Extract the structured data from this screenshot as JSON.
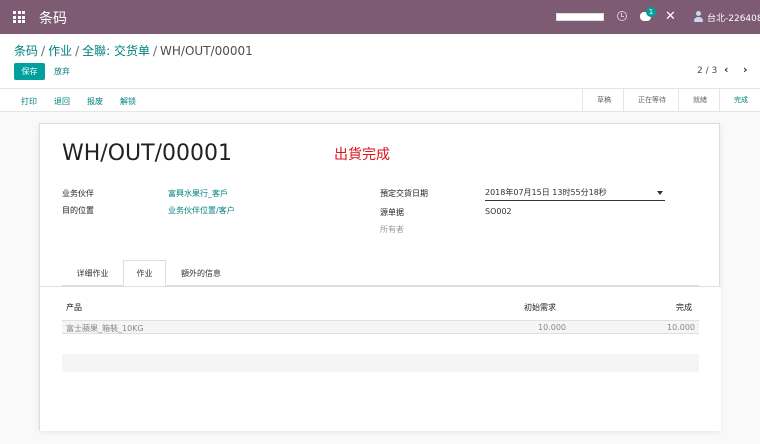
{
  "app": {
    "brand": "条码"
  },
  "navbar": {
    "chat_badge": "1",
    "close_glyph": "✕",
    "user_name": "台北-226408",
    "icons": [
      "apps-icon",
      "clock-icon",
      "chat-icon",
      "close-icon",
      "user-icon"
    ]
  },
  "breadcrumb": {
    "items": [
      "条码",
      "作业",
      "全聯: 交货单"
    ],
    "separator": "/",
    "current": "WH/OUT/00001"
  },
  "toolbar": {
    "save_label": "保存",
    "discard_label": "放弃",
    "pager": "2 / 3",
    "prev_glyph": "‹",
    "next_glyph": "›"
  },
  "actions": [
    "打印",
    "退回",
    "报废",
    "解锁"
  ],
  "status_steps": [
    {
      "label": "草稿",
      "active": false
    },
    {
      "label": "正在等待",
      "active": false
    },
    {
      "label": "就緒",
      "active": false
    },
    {
      "label": "完成",
      "active": true
    }
  ],
  "record": {
    "name": "WH/OUT/00001",
    "ribbon": "出貨完成",
    "partner_label": "业务伙伴",
    "partner_value": "富興水果行_客戶",
    "dest_label": "目的位置",
    "dest_value": "业务伙伴位置/客户",
    "scheduled_label": "預定交貨日期",
    "scheduled_value": "2018年07月15日 13时55分18秒",
    "origin_label": "源单据",
    "origin_value": "SO002",
    "owner_placeholder": "所有者"
  },
  "tabs": [
    {
      "label": "详细作业",
      "active": false
    },
    {
      "label": "作业",
      "active": true
    },
    {
      "label": "額外的信息",
      "active": false
    }
  ],
  "table": {
    "columns": [
      "产品",
      "初始需求",
      "完成"
    ],
    "rows": [
      {
        "product": "富士蘋果_箱裝_10KG",
        "demand": "10.000",
        "done": "10.000"
      }
    ]
  },
  "colors": {
    "navbar": "#7c5b73",
    "primary": "#00a09d",
    "link": "#00807c",
    "ribbon": "#e0121d"
  }
}
